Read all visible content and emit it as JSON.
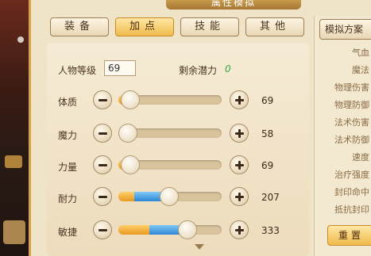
{
  "window": {
    "title": "属性模拟"
  },
  "tabs": [
    {
      "label": "装备",
      "active": false
    },
    {
      "label": "加点",
      "active": true
    },
    {
      "label": "技能",
      "active": false
    },
    {
      "label": "其他",
      "active": false
    }
  ],
  "character": {
    "level_label": "人物等级",
    "level_value": "69",
    "potential_label": "剩余潜力",
    "potential_value": "0"
  },
  "attributes": [
    {
      "name": "体质",
      "value": "69",
      "base_fraction": 0.1,
      "added_fraction": 0.0
    },
    {
      "name": "魔力",
      "value": "58",
      "base_fraction": 0.08,
      "added_fraction": 0.0
    },
    {
      "name": "力量",
      "value": "69",
      "base_fraction": 0.1,
      "added_fraction": 0.0
    },
    {
      "name": "耐力",
      "value": "207",
      "base_fraction": 0.15,
      "added_fraction": 0.32
    },
    {
      "name": "敏捷",
      "value": "333",
      "base_fraction": 0.3,
      "added_fraction": 0.35
    }
  ],
  "side_panel": {
    "title": "模拟方案",
    "stats": [
      "气血",
      "魔法",
      "物理伤害",
      "物理防御",
      "法术伤害",
      "法术防御",
      "速度",
      "治疗强度",
      "封印命中",
      "抵抗封印"
    ],
    "reset_label": "重置"
  },
  "colors": {
    "panel_bg": "#efe3c8",
    "accent_gold": "#f0bb4d",
    "bar_orange": "#e99a1f",
    "bar_blue": "#2d86d4",
    "potential_green": "#3ea83e"
  }
}
